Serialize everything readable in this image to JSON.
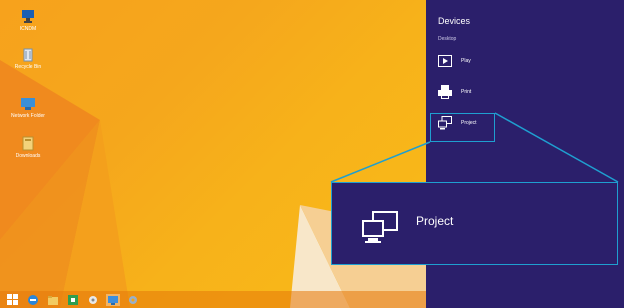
{
  "desktop": {
    "icons": [
      {
        "label": "ICNDM",
        "icon": "computer-icon"
      },
      {
        "label": "Recycle Bin",
        "icon": "recycle-bin-icon"
      },
      {
        "label": "Network Folder",
        "icon": "network-icon"
      },
      {
        "label": "Downloads",
        "icon": "folder-icon"
      }
    ]
  },
  "taskbar": {
    "items": [
      "windows-start-icon",
      "internet-explorer-icon",
      "file-explorer-icon",
      "store-icon",
      "media-icon",
      "network-share-icon",
      "settings-icon"
    ]
  },
  "charm": {
    "title": "Devices",
    "subtitle": "Desktop",
    "items": [
      {
        "label": "Play",
        "icon": "play-icon"
      },
      {
        "label": "Print",
        "icon": "printer-icon"
      },
      {
        "label": "Project",
        "icon": "project-icon"
      }
    ],
    "background": "#2b1f6b",
    "highlight": "#1f9fd0"
  },
  "callout": {
    "label": "Project",
    "icon": "project-icon"
  }
}
